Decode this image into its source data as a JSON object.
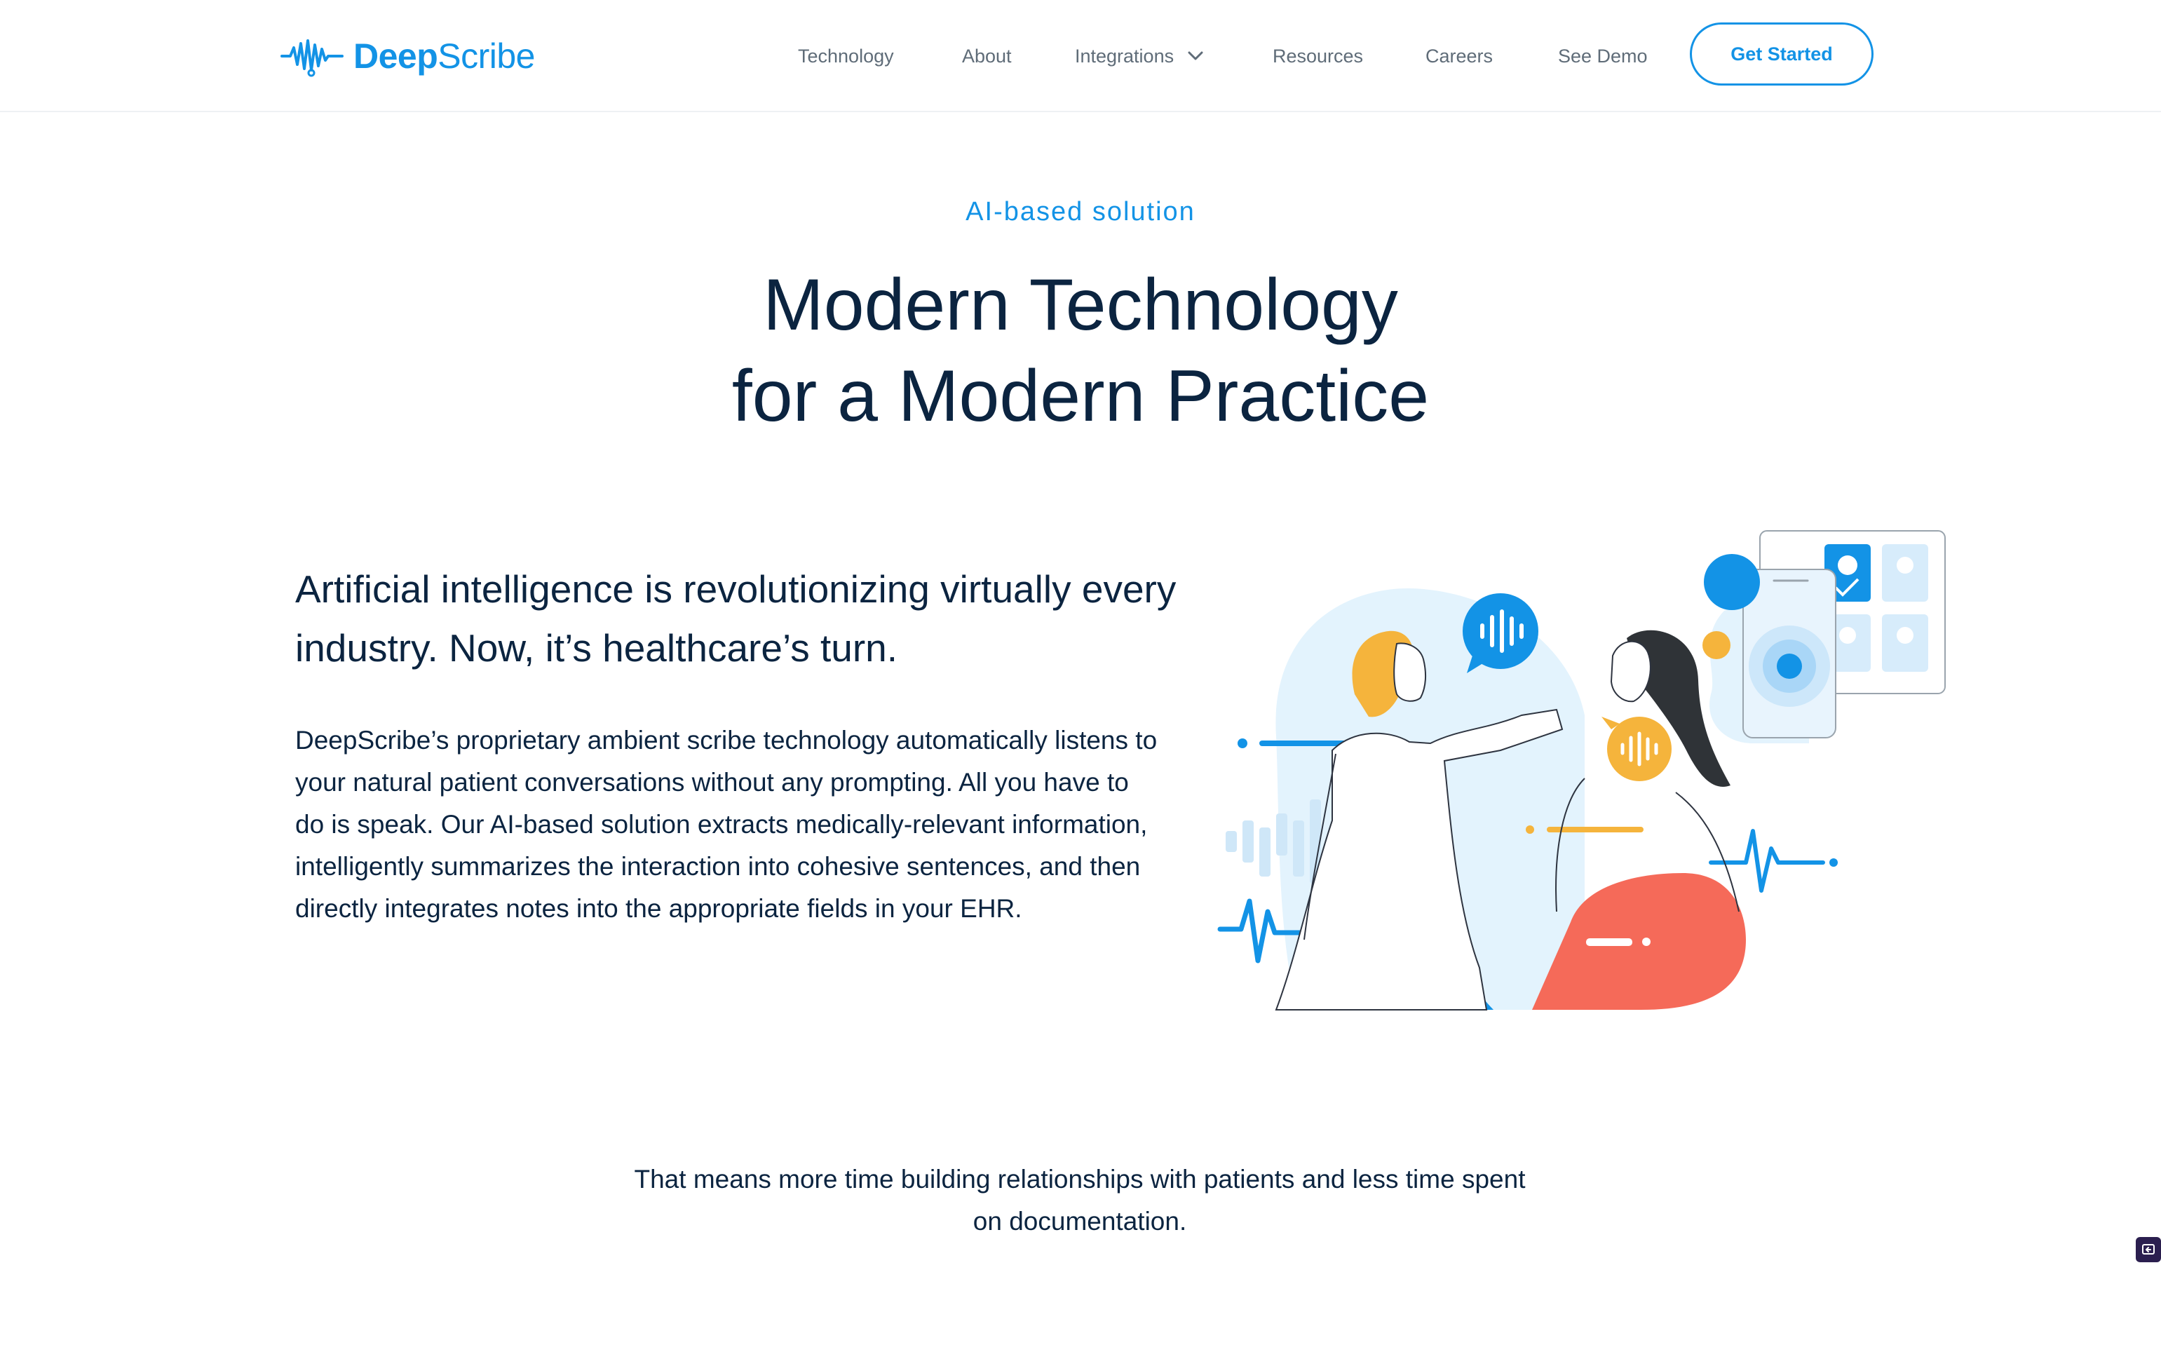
{
  "brand": {
    "name_bold": "Deep",
    "name_regular": "Scribe",
    "logo_icon": "waveform-stethoscope-icon",
    "accent_color": "#1393e6",
    "text_color": "#0b2440"
  },
  "nav": {
    "items": [
      "Technology",
      "About",
      "Integrations",
      "Resources",
      "Careers",
      "See Demo"
    ],
    "dropdown_icon": "chevron-down-icon",
    "cta_label": "Get Started"
  },
  "hero": {
    "eyebrow": "AI-based solution",
    "title_line1": "Modern Technology",
    "title_line2": "for a Modern Practice"
  },
  "content": {
    "heading": "Artificial intelligence is revolutionizing virtually every industry. Now, it’s healthcare’s turn.",
    "body": "DeepScribe’s proprietary ambient scribe technology automatically listens to your natural patient conversations without any prompting. All you have to do is speak. Our AI-based solution extracts medically-relevant information, intelligently summarizes the interaction into cohesive sentences, and then directly integrates notes into the appropriate fields in your EHR.",
    "closing": "That means more time building relationships with patients and less time spent on documentation."
  },
  "illustration": {
    "subject": "doctor-examining-patient-illustration",
    "colors": {
      "blue": "#1393e6",
      "light_blue": "#e3f3fd",
      "orange": "#f5b43c",
      "coral": "#f56a59"
    }
  },
  "feedback_tab": {
    "icon": "feedback-icon"
  }
}
